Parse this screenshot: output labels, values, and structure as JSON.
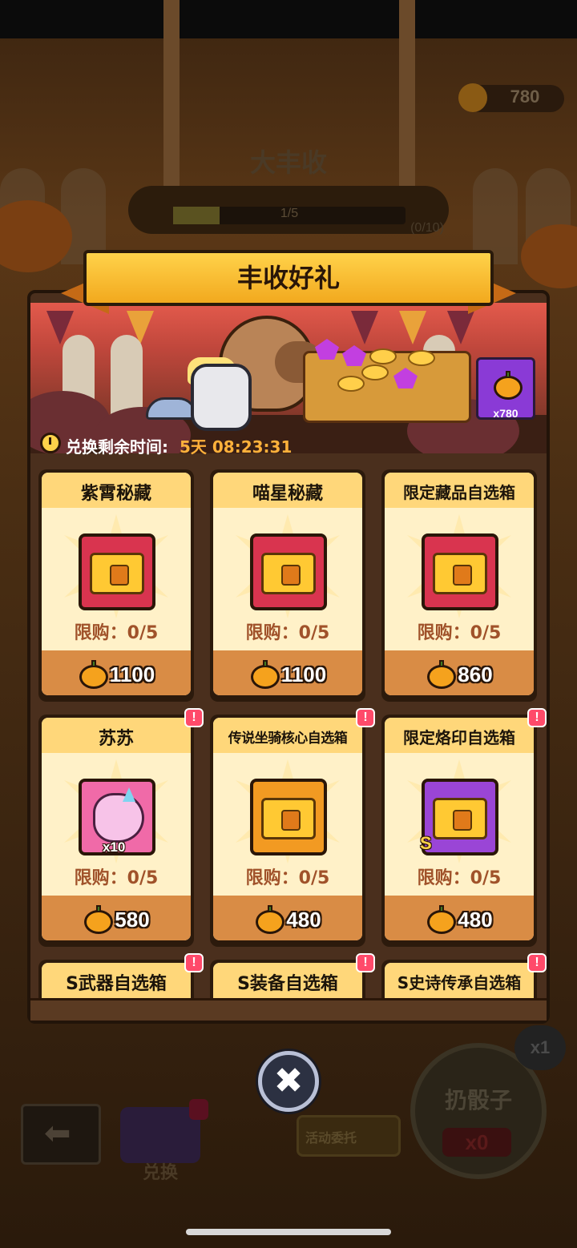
{
  "background": {
    "currency_value": "780",
    "event_title": "大丰收",
    "progress_text": "1/5",
    "progress_fraction": 0.2,
    "progress_count": "(0/10)",
    "exchange_label": "兑换",
    "commission_label": "活动委托",
    "dice_label": "扔骰子",
    "dice_count": "x0",
    "multiplier": "x1"
  },
  "dialog": {
    "title": "丰收好礼",
    "pumpkin_count": "x780",
    "timer_label": "兑换剩余时间:",
    "timer_value": "5天 08:23:31",
    "close_icon": "✖"
  },
  "items": [
    {
      "title": "紫霄秘藏",
      "limit": "限购：0/5",
      "price": "1100",
      "icon": "chest-icon",
      "frame_color": "#d9344f"
    },
    {
      "title": "喵星秘藏",
      "limit": "限购：0/5",
      "price": "1100",
      "icon": "chest-icon",
      "frame_color": "#d9344f"
    },
    {
      "title": "限定藏品自选箱",
      "limit": "限购：0/5",
      "price": "860",
      "icon": "chest-icon",
      "frame_color": "#d9344f"
    },
    {
      "title": "苏苏",
      "limit": "限购：0/5",
      "price": "580",
      "icon": "dragon-icon",
      "badge": "x10",
      "alert": "!",
      "frame_color": "#f06aa8"
    },
    {
      "title": "传说坐骑核心自选箱",
      "limit": "限购：0/5",
      "price": "480",
      "icon": "chest-icon",
      "alert": "!",
      "frame_color": "#f29a22"
    },
    {
      "title": "限定烙印自选箱",
      "limit": "限购：0/5",
      "price": "480",
      "icon": "chest-icon",
      "badge": "S",
      "alert": "!",
      "frame_color": "#9a45d6"
    },
    {
      "title": "S武器自选箱",
      "alert": "!"
    },
    {
      "title": "S装备自选箱",
      "alert": "!"
    },
    {
      "title": "S史诗传承自选箱",
      "alert": "!"
    }
  ]
}
